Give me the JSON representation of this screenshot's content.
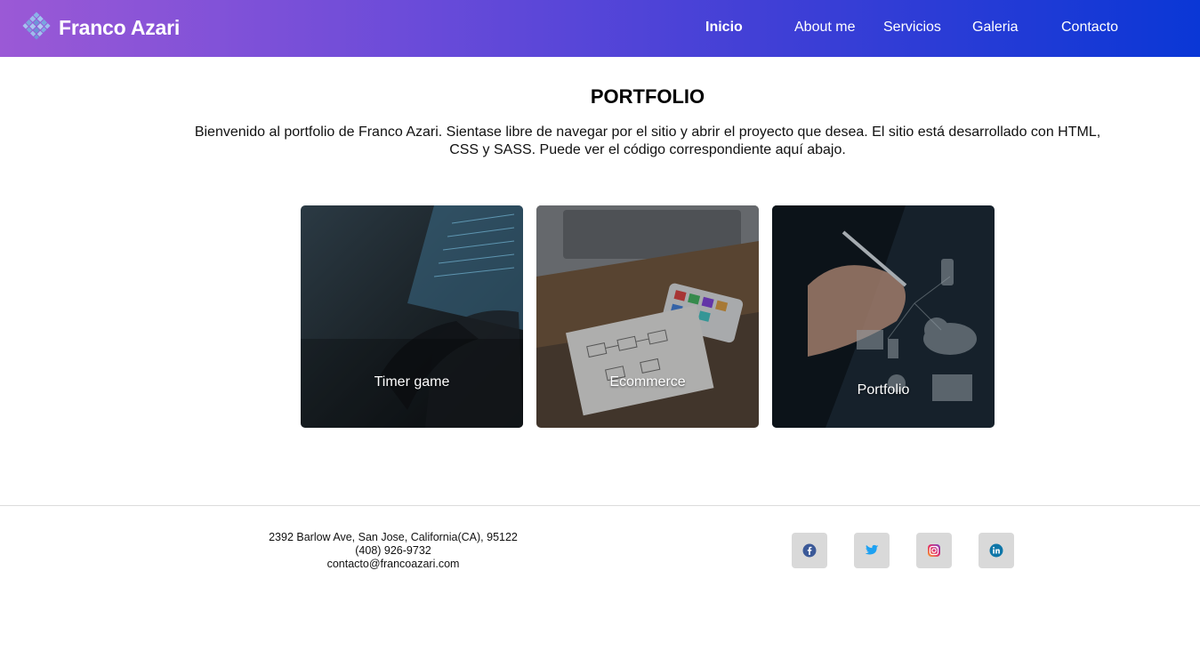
{
  "header": {
    "brand": "Franco Azari",
    "nav": [
      {
        "label": "Inicio",
        "active": true
      },
      {
        "label": "About me",
        "active": false
      },
      {
        "label": "Servicios",
        "active": false
      },
      {
        "label": "Galeria",
        "active": false
      },
      {
        "label": "Contacto",
        "active": false
      }
    ]
  },
  "main": {
    "title": "PORTFOLIO",
    "intro": "Bienvenido al portfolio de Franco Azari. Sientase libre de navegar por el sitio y abrir el proyecto que desea. El sitio está desarrollado con HTML, CSS y SASS. Puede ver el código correspondiente aquí abajo.",
    "projects": [
      {
        "label": "Timer game",
        "icon": "hand-tablet-photo"
      },
      {
        "label": "Ecommerce",
        "icon": "laptop-notebook-photo"
      },
      {
        "label": "Portfolio",
        "icon": "hand-pen-cloud-photo"
      }
    ]
  },
  "footer": {
    "address": "2392 Barlow Ave, San Jose, California(CA), 95122",
    "phone": "(408) 926-9732",
    "email": "contacto@francoazari.com",
    "social": [
      {
        "name": "facebook-icon",
        "color": "#3b5998"
      },
      {
        "name": "twitter-icon",
        "color": "#1da1f2"
      },
      {
        "name": "instagram-icon",
        "color": "#e1306c"
      },
      {
        "name": "linkedin-icon",
        "color": "#0e76a8"
      }
    ]
  }
}
